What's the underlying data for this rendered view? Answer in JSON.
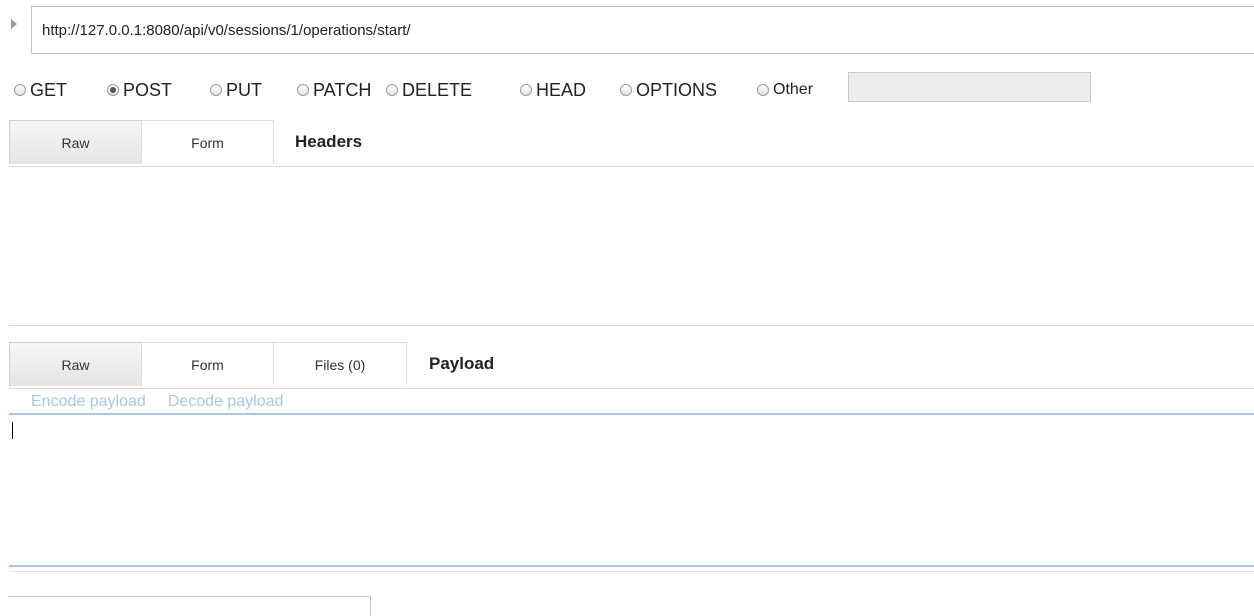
{
  "request": {
    "url": "http://127.0.0.1:8080/api/v0/sessions/1/operations/start/",
    "expand_icon": "triangle-right-icon"
  },
  "methods": [
    {
      "label": "GET",
      "checked": false
    },
    {
      "label": "POST",
      "checked": true
    },
    {
      "label": "PUT",
      "checked": false
    },
    {
      "label": "PATCH",
      "checked": false
    },
    {
      "label": "DELETE",
      "checked": false
    },
    {
      "label": "HEAD",
      "checked": false
    },
    {
      "label": "OPTIONS",
      "checked": false
    },
    {
      "label": "Other",
      "checked": false
    }
  ],
  "other_method": {
    "value": ""
  },
  "headers_section": {
    "tabs": [
      "Raw",
      "Form"
    ],
    "active_tab": "Raw",
    "title": "Headers"
  },
  "payload_section": {
    "tabs": [
      "Raw",
      "Form",
      "Files (0)"
    ],
    "active_tab": "Raw",
    "title": "Payload",
    "encode_label": "Encode payload",
    "decode_label": "Decode payload",
    "value": ""
  },
  "colors": {
    "link": "#a9c6e6",
    "focus_border": "#a6c6ea",
    "active_tab": "#e4e4e4",
    "other_input_bg": "#ececec"
  }
}
